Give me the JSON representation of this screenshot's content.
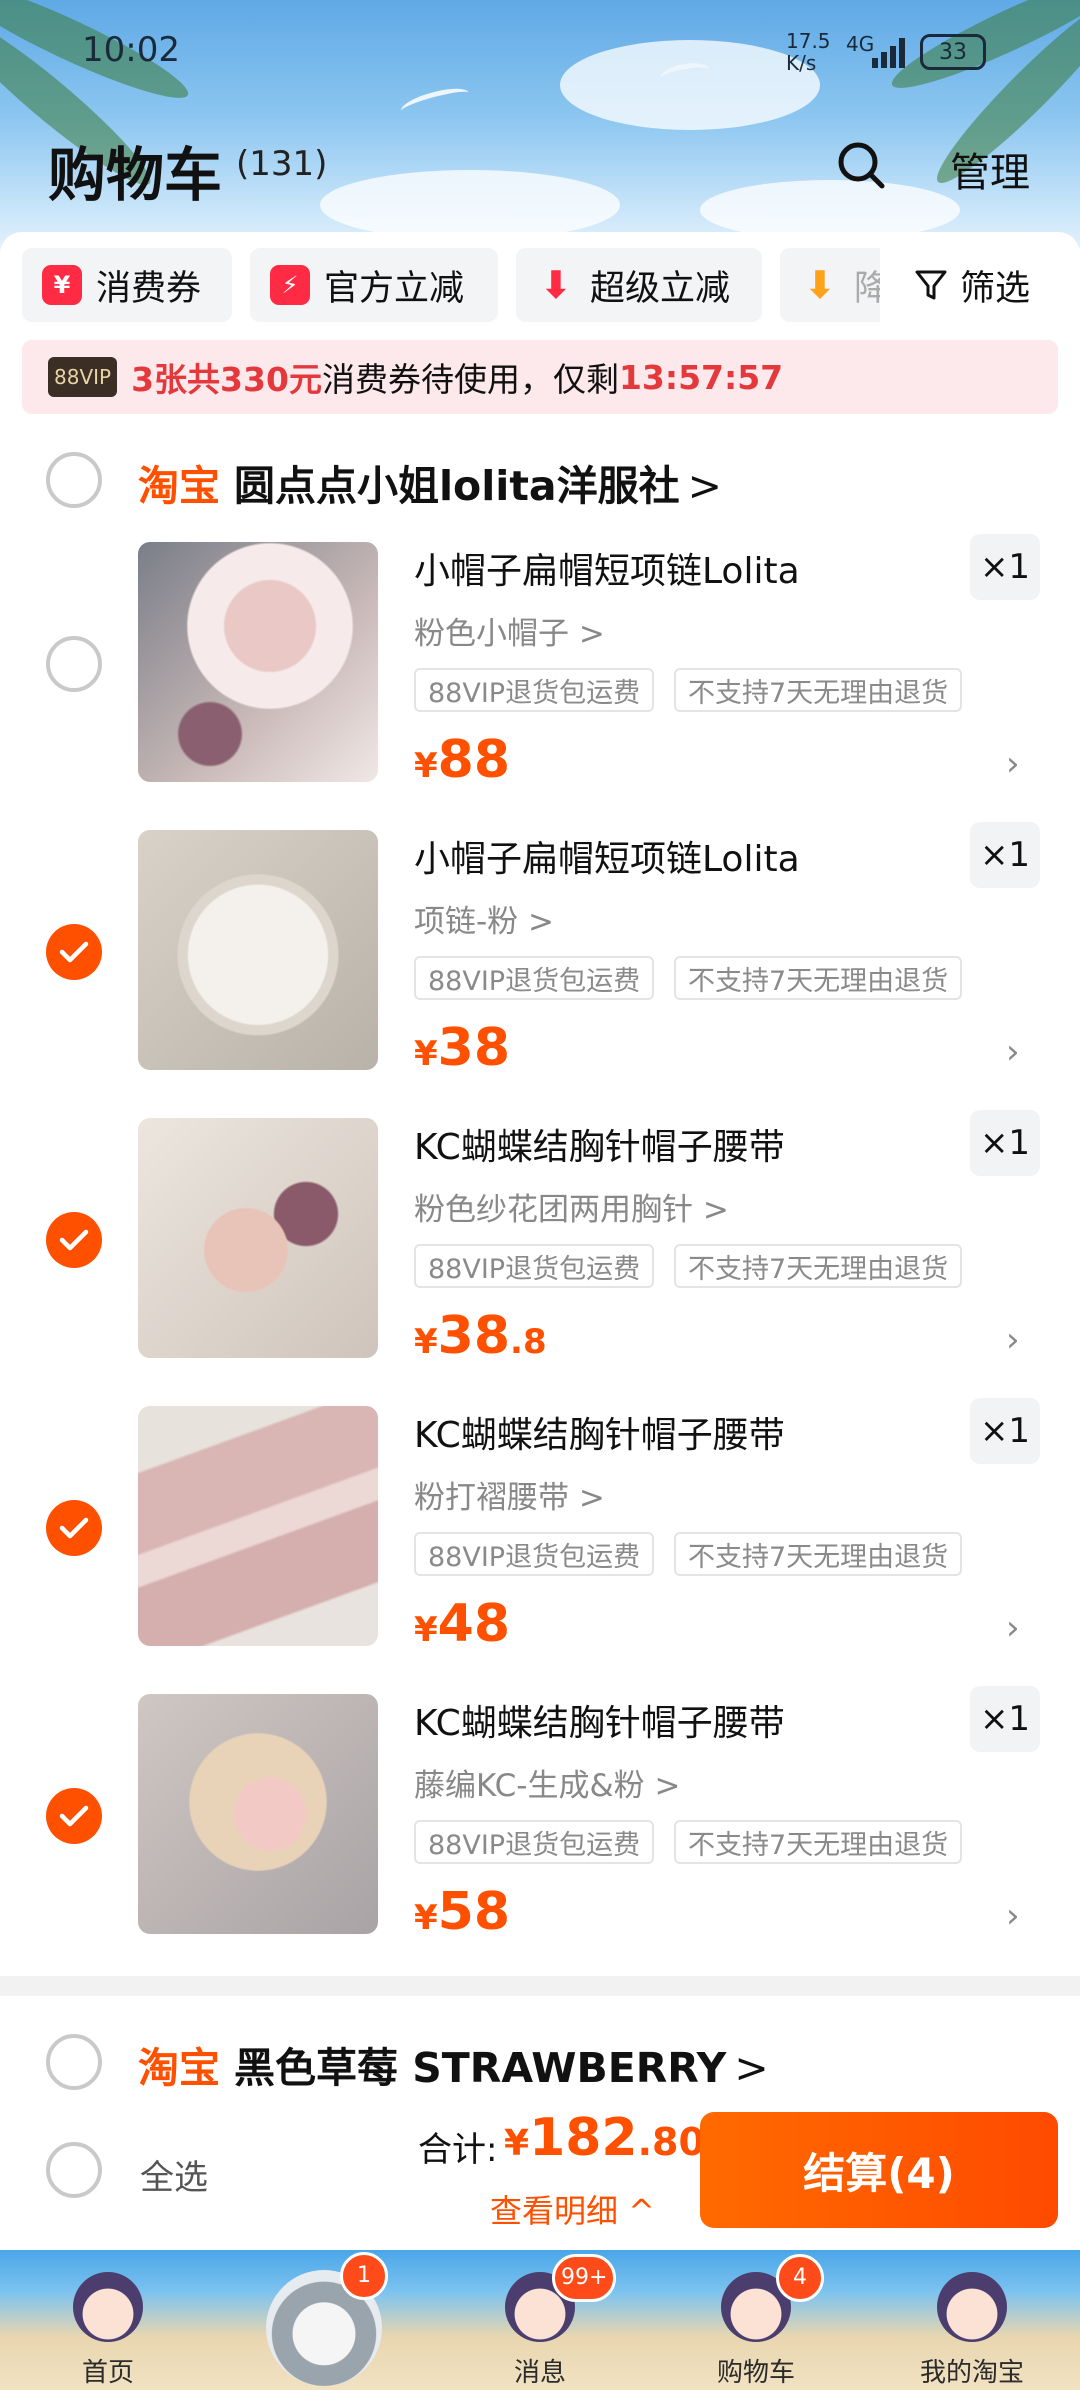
{
  "status": {
    "time": "10:02",
    "speed": "17.5 K/s",
    "net": "4G",
    "battery": "33"
  },
  "header": {
    "title": "购物车",
    "count": "(131)",
    "manage": "管理"
  },
  "chips": [
    {
      "label": "消费券",
      "icon": "coupon-icon",
      "color": "#ff2b45"
    },
    {
      "label": "官方立减",
      "icon": "lightning-icon",
      "color": "#ff2b45"
    },
    {
      "label": "超级立减",
      "icon": "down-arrow-icon",
      "color": "#ff2b45"
    },
    {
      "label": "降",
      "icon": "price-drop-icon",
      "color": "#ffa21a"
    }
  ],
  "filter": {
    "label": "筛选"
  },
  "vip": {
    "badge": "88VIP",
    "p1": "3张共330元",
    "p2": "消费券待使用，仅剩",
    "timer": "13:57:57"
  },
  "shops": [
    {
      "tag": "淘宝",
      "name": "圆点点小姐lolita洋服社",
      "arrow": ">"
    },
    {
      "tag": "淘宝",
      "name": "黑色草莓 STRAWBERRY",
      "arrow": ">"
    }
  ],
  "items": [
    {
      "name": "小帽子扁帽短项链Lolita",
      "sku": "粉色小帽子 >",
      "tags": [
        "88VIP退货包运费",
        "不支持7天无理由退货"
      ],
      "currency": "¥",
      "price": "88",
      "decimal": "",
      "qty": "×1",
      "checked": false
    },
    {
      "name": "小帽子扁帽短项链Lolita",
      "sku": "项链-粉 >",
      "tags": [
        "88VIP退货包运费",
        "不支持7天无理由退货"
      ],
      "currency": "¥",
      "price": "38",
      "decimal": "",
      "qty": "×1",
      "checked": true
    },
    {
      "name": "KC蝴蝶结胸针帽子腰带",
      "sku": "粉色纱花团两用胸针 >",
      "tags": [
        "88VIP退货包运费",
        "不支持7天无理由退货"
      ],
      "currency": "¥",
      "price": "38",
      "decimal": ".8",
      "qty": "×1",
      "checked": true
    },
    {
      "name": "KC蝴蝶结胸针帽子腰带",
      "sku": "粉打褶腰带 >",
      "tags": [
        "88VIP退货包运费",
        "不支持7天无理由退货"
      ],
      "currency": "¥",
      "price": "48",
      "decimal": "",
      "qty": "×1",
      "checked": true
    },
    {
      "name": "KC蝴蝶结胸针帽子腰带",
      "sku": "藤编KC-生成&粉 >",
      "tags": [
        "88VIP退货包运费",
        "不支持7天无理由退货"
      ],
      "currency": "¥",
      "price": "58",
      "decimal": "",
      "qty": "×1",
      "checked": true
    }
  ],
  "bottom": {
    "select_all": "全选",
    "total_label": "合计:",
    "total_currency": "¥",
    "total_int": "182",
    "total_dec": ".80",
    "detail": "查看明细 ^",
    "checkout": "结算(4)"
  },
  "tabs": [
    {
      "label": "首页",
      "badge": ""
    },
    {
      "label": "",
      "badge": "1"
    },
    {
      "label": "消息",
      "badge": "99+"
    },
    {
      "label": "购物车",
      "badge": "4"
    },
    {
      "label": "我的淘宝",
      "badge": ""
    }
  ]
}
